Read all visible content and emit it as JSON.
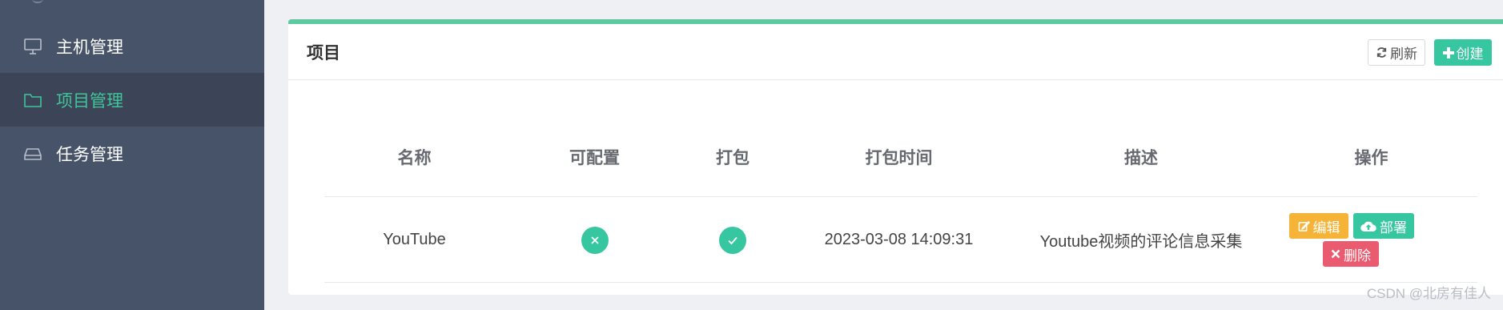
{
  "sidebar": {
    "items": [
      {
        "label": "主机管理",
        "icon": "monitor-icon",
        "active": false
      },
      {
        "label": "项目管理",
        "icon": "folder-icon",
        "active": true
      },
      {
        "label": "任务管理",
        "icon": "drive-icon",
        "active": false
      }
    ]
  },
  "card": {
    "title": "项目",
    "refresh_label": "刷新",
    "create_label": "创建",
    "accent_color": "#5ec9a0"
  },
  "table": {
    "headers": [
      "名称",
      "可配置",
      "打包",
      "打包时间",
      "描述",
      "操作"
    ],
    "rows": [
      {
        "name": "YouTube",
        "configurable": "x-icon",
        "packaged": "check-icon",
        "pack_time": "2023-03-08 14:09:31",
        "description": "Youtube视频的评论信息采集",
        "actions": {
          "edit": "编辑",
          "deploy": "部署",
          "delete": "删除"
        }
      }
    ]
  },
  "watermark": "CSDN @北房有佳人",
  "colors": {
    "sidebar_bg": "#475369",
    "sidebar_active_bg": "#3b4557",
    "active_text": "#42c49b",
    "primary": "#36c6a0",
    "warning": "#f5b437",
    "danger": "#ea5b6f"
  }
}
